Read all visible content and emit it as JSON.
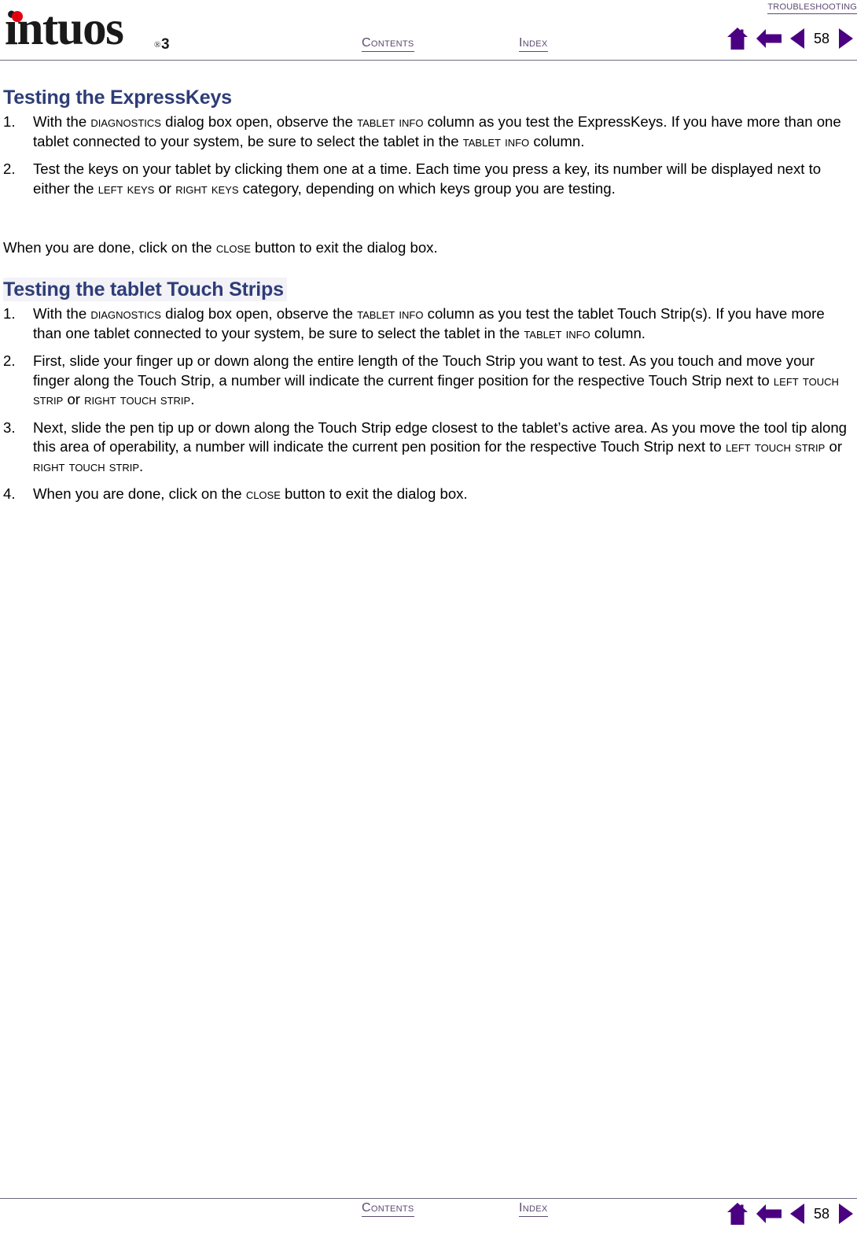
{
  "header": {
    "logo": {
      "wordmark": "intuos",
      "registered": "®",
      "model": "3",
      "dot_color": "#e2000f"
    },
    "breadcrumb_label": "TROUBLESHOOTING",
    "contents_label": "CONTENTS",
    "index_label": "INDEX",
    "nav": {
      "home_icon": "home-icon",
      "back_icon": "back-arrow-icon",
      "prev_icon": "previous-page-icon",
      "next_icon": "next-page-icon",
      "page_number": "58"
    }
  },
  "footer": {
    "contents_label": "CONTENTS",
    "index_label": "INDEX",
    "nav": {
      "home_icon": "home-icon",
      "back_icon": "back-arrow-icon",
      "prev_icon": "previous-page-icon",
      "next_icon": "next-page-icon",
      "page_number": "58"
    }
  },
  "colors": {
    "heading": "#2e3d77",
    "link": "#5c4a72",
    "nav_icon": "#4b0082",
    "logo_dot": "#e2000f",
    "rule": "#6b6b7d"
  },
  "sections": [
    {
      "title": "Testing the ExpressKeys",
      "highlighted": false,
      "steps": [
        {
          "num": "1.",
          "parts": [
            {
              "t": "With the ",
              "sc": false
            },
            {
              "t": "DIAGNOSTICS",
              "sc": true
            },
            {
              "t": " dialog box open, observe the ",
              "sc": false
            },
            {
              "t": "TABLET INFO",
              "sc": true
            },
            {
              "t": " column as you test the ExpressKeys.  If you have more than one tablet connected to your system, be sure to select the tablet in the ",
              "sc": false
            },
            {
              "t": "TABLET INFO",
              "sc": true
            },
            {
              "t": " column.",
              "sc": false
            }
          ]
        },
        {
          "num": "2.",
          "parts": [
            {
              "t": "Test the keys on your tablet by clicking them one at a time.  Each time you press a key, its number will be displayed next to either the ",
              "sc": false
            },
            {
              "t": "LEFT KEYS",
              "sc": true
            },
            {
              "t": " or ",
              "sc": false
            },
            {
              "t": "RIGHT KEYS",
              "sc": true
            },
            {
              "t": " category, depending on which keys group you are testing.",
              "sc": false
            }
          ]
        }
      ],
      "paragraph": [
        {
          "t": "When you are done, click on the ",
          "sc": false
        },
        {
          "t": "CLOSE",
          "sc": true
        },
        {
          "t": " button to exit the dialog box.",
          "sc": false
        }
      ]
    },
    {
      "title": "Testing the tablet Touch Strips",
      "highlighted": true,
      "steps": [
        {
          "num": "1.",
          "parts": [
            {
              "t": "With the ",
              "sc": false
            },
            {
              "t": "DIAGNOSTICS",
              "sc": true
            },
            {
              "t": " dialog box open, observe the ",
              "sc": false
            },
            {
              "t": "TABLET INFO",
              "sc": true
            },
            {
              "t": " column as you test the tablet Touch Strip(s).  If you have more than one tablet connected to your system, be sure to select the tablet in the ",
              "sc": false
            },
            {
              "t": "TABLET INFO",
              "sc": true
            },
            {
              "t": " column.",
              "sc": false
            }
          ]
        },
        {
          "num": "2.",
          "parts": [
            {
              "t": "First, slide your finger up or down along the entire length of the Touch Strip you want to test.  As you touch and move your finger along the Touch Strip, a number will indicate the current finger position for the respective Touch Strip next to ",
              "sc": false
            },
            {
              "t": "LEFT TOUCH STRIP",
              "sc": true
            },
            {
              "t": " or ",
              "sc": false
            },
            {
              "t": "RIGHT TOUCH STRIP",
              "sc": true
            },
            {
              "t": ".",
              "sc": false
            }
          ]
        },
        {
          "num": "3.",
          "parts": [
            {
              "t": "Next, slide the pen tip up or down along the Touch Strip edge closest to the tablet’s active area.  As you move the tool tip along this area of operability, a number will indicate the current pen position for the respective Touch Strip next to ",
              "sc": false
            },
            {
              "t": "LEFT TOUCH STRIP",
              "sc": true
            },
            {
              "t": " or ",
              "sc": false
            },
            {
              "t": "RIGHT TOUCH STRIP",
              "sc": true
            },
            {
              "t": ".",
              "sc": false
            }
          ]
        },
        {
          "num": "4.",
          "parts": [
            {
              "t": "When you are done, click on the ",
              "sc": false
            },
            {
              "t": "CLOSE",
              "sc": true
            },
            {
              "t": " button to exit the dialog box.",
              "sc": false
            }
          ]
        }
      ],
      "paragraph": null
    }
  ]
}
